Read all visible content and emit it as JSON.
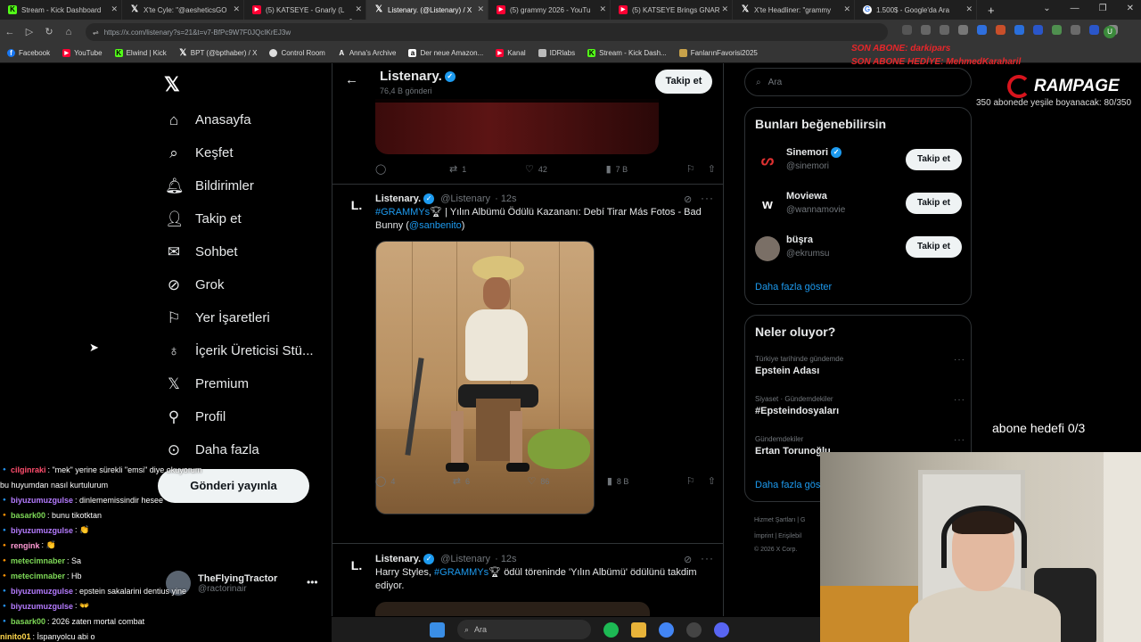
{
  "browser": {
    "tabs": [
      {
        "title": "Stream - Kick Dashboard",
        "icon": "kick-icon"
      },
      {
        "title": "X'te Cyle: \"@aesheticsGO",
        "icon": "x-icon"
      },
      {
        "title": "(5) KATSEYE - Gnarly (L",
        "icon": "youtube-icon"
      },
      {
        "title": "Listenary. (@Listenary) / X",
        "icon": "x-icon"
      },
      {
        "title": "(5) grammy 2026 - YouTu",
        "icon": "youtube-icon"
      },
      {
        "title": "(5) KATSEYE Brings GNAR",
        "icon": "youtube-icon"
      },
      {
        "title": "X'te Headliner: \"grammy",
        "icon": "x-icon"
      },
      {
        "title": "1.500$ - Google'da Ara",
        "icon": "google-icon"
      }
    ],
    "tab_badge": "x2",
    "url": "https://x.com/listenary?s=21&t=v7-BfPc9W7F0JQcIKrEJ3w",
    "bookmarks": [
      "Facebook",
      "YouTube",
      "Elwind | Kick",
      "BPT (@bpthaber) / X",
      "Control Room",
      "Anna's Archive",
      "Der neue Amazon...",
      "Kanal",
      "IDRlabs",
      "Stream - Kick Dash...",
      "FanlarınFavorisi2025"
    ]
  },
  "overlay": {
    "son_abone": "SON ABONE: darkipars",
    "son_hediye": "SON ABONE HEDİYE: MehmedKaraharil",
    "brand": "RAMPAGE",
    "sub_goal_line": "350 abonede yeşile boyanacak: 80/350",
    "abone_hedefi": "abone hedefi 0/3"
  },
  "left_nav": {
    "items": [
      {
        "label": "Anasayfa",
        "icon": "home-icon"
      },
      {
        "label": "Keşfet",
        "icon": "search-icon"
      },
      {
        "label": "Bildirimler",
        "icon": "bell-icon"
      },
      {
        "label": "Takip et",
        "icon": "add-person-icon"
      },
      {
        "label": "Sohbet",
        "icon": "mail-icon"
      },
      {
        "label": "Grok",
        "icon": "grok-icon"
      },
      {
        "label": "Yer İşaretleri",
        "icon": "bookmark-icon"
      },
      {
        "label": "İçerik Üreticisi Stü...",
        "icon": "creator-icon"
      },
      {
        "label": "Premium",
        "icon": "x-premium-icon"
      },
      {
        "label": "Profil",
        "icon": "person-icon"
      },
      {
        "label": "Daha fazla",
        "icon": "more-circle-icon"
      }
    ],
    "post_button": "Gönderi yayınla",
    "account": {
      "name": "TheFlyingTractor",
      "handle": "@ractorinair"
    }
  },
  "profile_header": {
    "name": "Listenary.",
    "post_count": "76,4 B gönderi",
    "follow_label": "Takip et"
  },
  "prev_tweet_actions": {
    "replies": "",
    "reposts": "1",
    "likes": "42",
    "views": "7 B"
  },
  "tweet1": {
    "avatar": "L.",
    "name": "Listenary.",
    "handle": "@Listenary",
    "time": "· 12s",
    "hashtag": "#GRAMMYs",
    "text": "| Yılın Albümü Ödülü Kazananı: Debí Tirar Más Fotos - Bad Bunny (",
    "mention": "@sanbenito",
    "text_end": ")",
    "actions": {
      "replies": "4",
      "reposts": "6",
      "likes": "86",
      "views": "8 B"
    }
  },
  "tweet2": {
    "avatar": "L.",
    "name": "Listenary.",
    "handle": "@Listenary",
    "time": "· 12s",
    "text_start": "Harry Styles,",
    "hashtag": "#GRAMMYs",
    "text": "ödül töreninde 'Yılın Albümü' ödülünü takdim ediyor."
  },
  "right": {
    "search_placeholder": "Ara",
    "suggest_title": "Bunları beğenebilirsin",
    "suggestions": [
      {
        "name": "Sinemori",
        "handle": "@sinemori",
        "verified": true,
        "button": "Takip et"
      },
      {
        "name": "Moviewa",
        "handle": "@wannamovie",
        "verified": false,
        "button": "Takip et"
      },
      {
        "name": "büşra",
        "handle": "@ekrumsu",
        "verified": false,
        "button": "Takip et"
      }
    ],
    "show_more": "Daha fazla göster",
    "trends_title": "Neler oluyor?",
    "trends": [
      {
        "context": "Türkiye tarihinde gündemde",
        "title": "Epstein Adası"
      },
      {
        "context": "Siyaset · Gündemdekiler",
        "title": "#Epsteindosyaları"
      },
      {
        "context": "Gündemdekiler",
        "title": "Ertan Torunoğlu"
      }
    ],
    "trends_more": "Daha fazla göster",
    "footer": [
      "Hizmet Şartları | G",
      "İmprint | Erişilebil",
      "© 2026 X Corp."
    ]
  },
  "chat": [
    {
      "user": "cilginraki",
      "msg": ": \"mek\" yerine sürekli \"emsi\" diye okuyorum",
      "color": "#ff4d6d"
    },
    {
      "user": "",
      "msg": "bu huyumdan nasıl kurtulurum",
      "color": "#ffffff"
    },
    {
      "user": "biyuzumuzgulse",
      "msg": ": dinlememissindir hesee",
      "color": "#b57bff"
    },
    {
      "user": "basark00",
      "msg": ": bunu tikotktan",
      "color": "#7ed957"
    },
    {
      "user": "biyuzumuzgulse",
      "msg": ": 👏",
      "color": "#b57bff"
    },
    {
      "user": "rengink",
      "msg": ": 👏",
      "color": "#ff9ad5"
    },
    {
      "user": "metecimnaber",
      "msg": ": Sa",
      "color": "#7ed957"
    },
    {
      "user": "metecimnaber",
      "msg": ": Hb",
      "color": "#7ed957"
    },
    {
      "user": "biyuzumuzgulse",
      "msg": ": epstein sakalarini dentius yine",
      "color": "#b57bff"
    },
    {
      "user": "biyuzumuzgulse",
      "msg": ": 👐",
      "color": "#b57bff"
    },
    {
      "user": "basark00",
      "msg": ": 2026 zaten mortal combat",
      "color": "#7ed957"
    },
    {
      "user": "ninito01",
      "msg": ": İspanyolcu abi o",
      "color": "#ffd84d"
    }
  ],
  "taskbar": {
    "search_placeholder": "Ara"
  }
}
